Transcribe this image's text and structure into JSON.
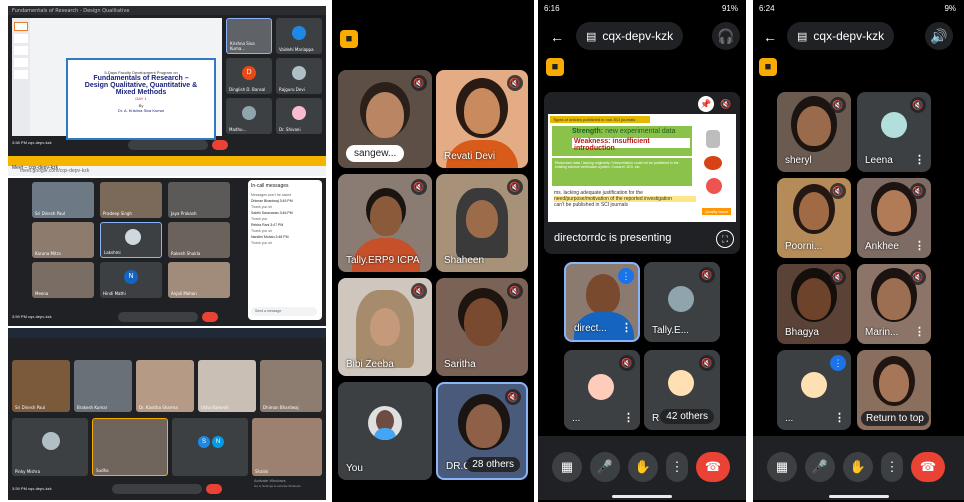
{
  "panel1": {
    "screen1": {
      "titlebar": "Fundamentals of Research - Design Qualitative",
      "slide": {
        "header": "5-Days Faculty Development Program on",
        "title1": "Fundamentals of Research –",
        "title2": "Design Qualitative, Quantitative &",
        "title3": "Mixed Methods",
        "day": "DAY 1",
        "by": "By",
        "speaker": "Dr. A. Krishna Siva Kumar"
      },
      "side_names": [
        "Krishna Siva Kuma...",
        "Vaidehi Mariappa",
        "Dinglish D. Bansal",
        "Rajguru Devi",
        "Madhu...",
        "Dr. Shivani"
      ],
      "time": "3:58 PM  cqx-depv-kzk"
    },
    "screen2": {
      "titlebar": "Meet – cqx-depv-kzk",
      "url": "meet.google.com/cqx-depv-kzk",
      "tile_names": [
        "Sri Dinesh Paul",
        "Pradeep Singh",
        "Jaya Prakash",
        "Karuna Mitra",
        "Lakshmi",
        "Rakesh Shukla",
        "Meena",
        "Hindi Mathi",
        "Anjali Mohan"
      ],
      "chat_title": "In-call messages",
      "chat_lines": [
        "Messages won't be saved",
        "Dhiman Bhardwaj 3:45 PM",
        "Thank you sir",
        "Sakthi Saravanan 3:46 PM",
        "Thank you",
        "Rekha Rani 3:47 PM",
        "Thank you sir",
        "Nandini Mohan 3:48 PM",
        "Thank you sir"
      ],
      "chat_input": "Send a message",
      "time": "3:59 PM  cqx-depv-kzk"
    },
    "screen3": {
      "tile_names": [
        "Sri Dinesh Paul",
        "Brakesh Kumar",
        "Dr. Kavitha Sharma",
        "Usha Ramesh",
        "Dhiman Bhardwaj",
        "Pinky Mishra",
        "Sudha",
        "Shalini"
      ],
      "avatar_letters": [
        "S",
        "N"
      ],
      "time": "3:59 PM  cqx-depv-kzk",
      "watermark1": "Activate Windows",
      "watermark2": "Go to Settings to activate Windows."
    }
  },
  "panel2": {
    "participants": [
      {
        "name": "sangew..."
      },
      {
        "name": "Revati Devi"
      },
      {
        "name": "Tally.ERP9 ICPA"
      },
      {
        "name": "Shaheen"
      },
      {
        "name": "Bibi Zeeba"
      },
      {
        "name": "Saritha"
      },
      {
        "name": "You"
      },
      {
        "name": "DR.G"
      }
    ],
    "others": "28 others",
    "icons": {
      "mute": "mic-off-icon",
      "badge": "meet-badge-icon"
    }
  },
  "panel3": {
    "status_time": "6:16",
    "status_right": "91%",
    "meeting_code": "cqx-depv-kzk",
    "presenting": "directorrdc is presenting",
    "slide": {
      "head": "Types of articles published in non-SCI journals",
      "strength_label": "Strength:",
      "strength": "new experimental data",
      "weakness_label": "Weakness:",
      "weakness": "insufficient introduction",
      "bullet1": "Redundant data / lacking originality / Interpretation could not be published in the existing science verification system: Crossref, DOI, etc.",
      "bullet2_a": "ms. lacking adequate justification for the",
      "bullet2_b": "need/purpose/motivation of the reported investigation",
      "bullet2_c": "can't be published in SCI journals",
      "tag": "Quality Issue"
    },
    "tiles": [
      {
        "name": "direct..."
      },
      {
        "name": "Tally.E..."
      },
      {
        "name": "..."
      },
      {
        "name": "R"
      }
    ],
    "others": "42 others"
  },
  "panel4": {
    "status_time": "6:24",
    "status_right": "9%",
    "meeting_code": "cqx-depv-kzk",
    "tiles": [
      {
        "name": "sheryl"
      },
      {
        "name": "Leena"
      },
      {
        "name": "Poorni..."
      },
      {
        "name": "Ankhee"
      },
      {
        "name": "Bhagya"
      },
      {
        "name": "Marin..."
      },
      {
        "name": "..."
      },
      {
        "name": "Return to top"
      }
    ]
  },
  "colors": {
    "end_call": "#ea4335",
    "tile_bg": "#3c4043",
    "meet_badge": "#f9ab00",
    "active_border": "#8ab4f8"
  }
}
